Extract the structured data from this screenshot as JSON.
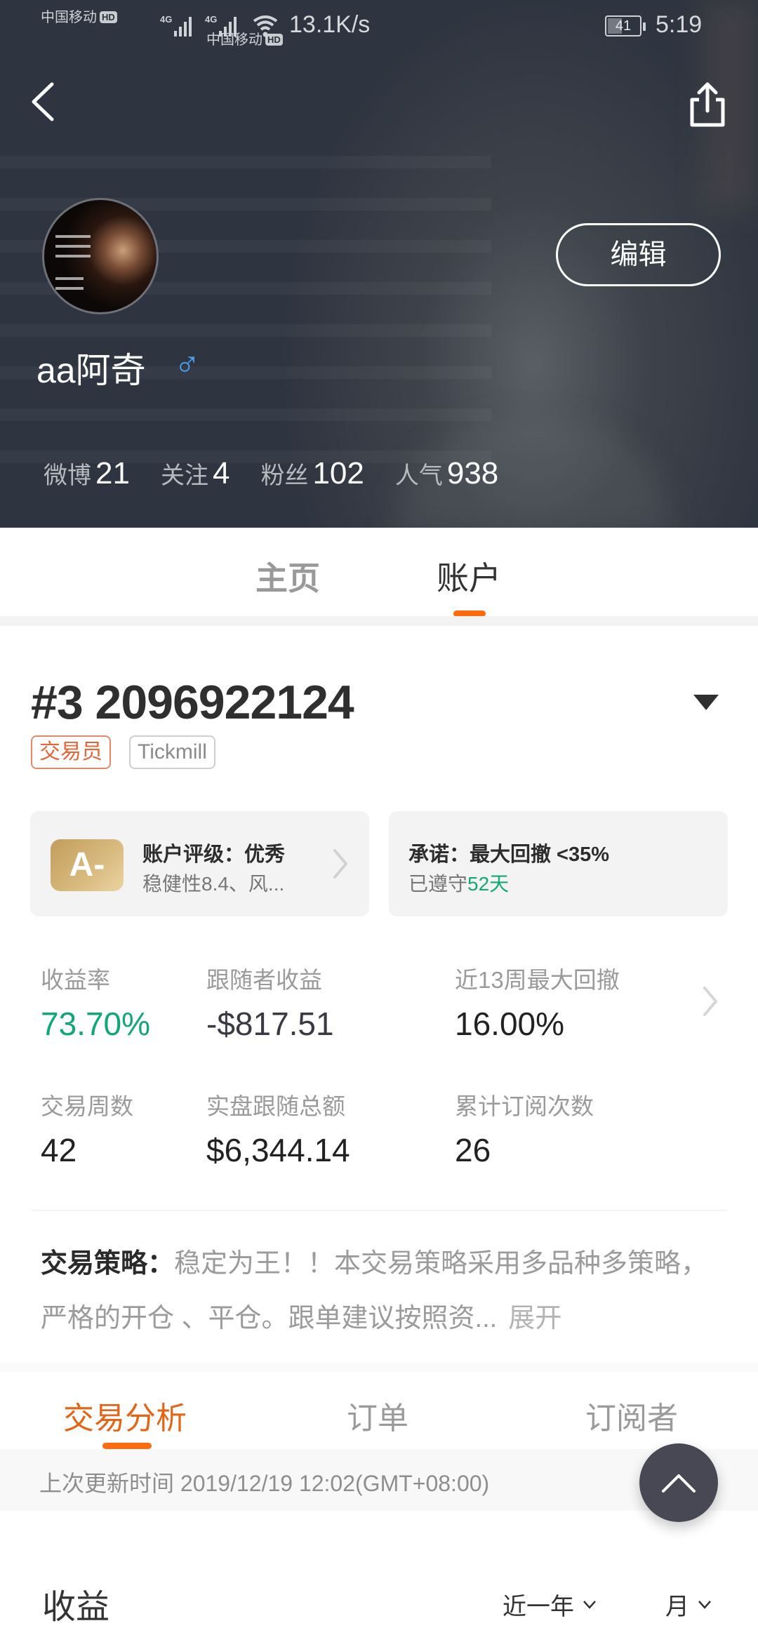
{
  "status_bar": {
    "carrier_1": "中国移动",
    "carrier_2": "中国移动",
    "hd_badge": "HD",
    "network_type": "4G",
    "net_speed": "13.1K/s",
    "battery": "41",
    "time": "5:19"
  },
  "header": {
    "back_icon": "chevron-left-icon",
    "share_icon": "share-icon",
    "edit_label": "编辑",
    "username": "aa阿奇",
    "gender_symbol": "♂",
    "stats": [
      {
        "label": "微博",
        "value": "21"
      },
      {
        "label": "关注",
        "value": "4"
      },
      {
        "label": "粉丝",
        "value": "102"
      },
      {
        "label": "人气",
        "value": "938"
      }
    ]
  },
  "main_tabs": [
    {
      "label": "主页",
      "active": false
    },
    {
      "label": "账户",
      "active": true
    }
  ],
  "account": {
    "id": "#3 2096922124",
    "tags": [
      "交易员",
      "Tickmill"
    ],
    "rating_card": {
      "badge": "A-",
      "title": "账户评级：优秀",
      "subtitle": "稳健性8.4、风..."
    },
    "promise_card": {
      "title": "承诺：最大回撤 <35%",
      "subtitle_prefix": "已遵守",
      "subtitle_highlight": "52天"
    },
    "metrics": [
      {
        "label": "收益率",
        "value": "73.70%"
      },
      {
        "label": "跟随者收益",
        "value": "-$817.51"
      },
      {
        "label": "近13周最大回撤",
        "value": "16.00%"
      },
      {
        "label": "交易周数",
        "value": "42"
      },
      {
        "label": "实盘跟随总额",
        "value": "$6,344.14"
      },
      {
        "label": "累计订阅次数",
        "value": "26"
      }
    ],
    "strategy": {
      "label": "交易策略：",
      "text": "稳定为王！！本交易策略采用多品种多策略，严格的开仓 、平仓。跟单建议按照资...",
      "expand": "展开"
    }
  },
  "sub_tabs": [
    {
      "label": "交易分析",
      "active": true
    },
    {
      "label": "订单",
      "active": false
    },
    {
      "label": "订阅者",
      "active": false
    }
  ],
  "update_time": "上次更新时间 2019/12/19 12:02(GMT+08:00)",
  "profit_section": {
    "title": "收益",
    "range_filter": "近一年",
    "period_filter": "月"
  },
  "colors": {
    "accent": "#ff6a0c",
    "positive": "#12a876",
    "male": "#4a9ff0"
  }
}
